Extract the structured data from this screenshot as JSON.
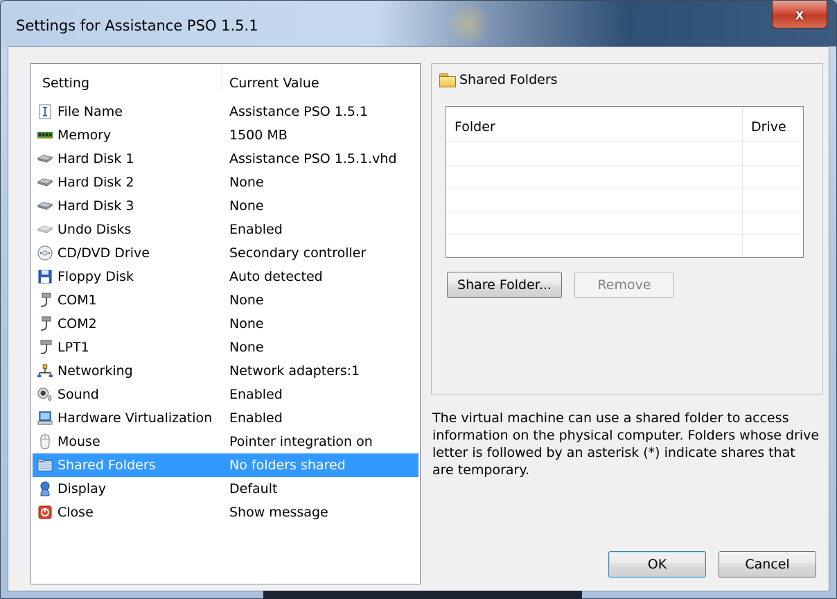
{
  "window": {
    "title": "Settings for Assistance PSO 1.5.1",
    "close_glyph": "x"
  },
  "settings_list": {
    "columns": [
      "Setting",
      "Current Value"
    ],
    "items": [
      {
        "icon": "file-name-icon",
        "label": "File Name",
        "value": "Assistance PSO 1.5.1"
      },
      {
        "icon": "memory-icon",
        "label": "Memory",
        "value": "1500 MB"
      },
      {
        "icon": "hard-disk-icon",
        "label": "Hard Disk 1",
        "value": "Assistance PSO 1.5.1.vhd"
      },
      {
        "icon": "hard-disk-icon",
        "label": "Hard Disk 2",
        "value": "None"
      },
      {
        "icon": "hard-disk-icon",
        "label": "Hard Disk 3",
        "value": "None"
      },
      {
        "icon": "undo-disks-icon",
        "label": "Undo Disks",
        "value": "Enabled"
      },
      {
        "icon": "cd-dvd-icon",
        "label": "CD/DVD Drive",
        "value": "Secondary controller"
      },
      {
        "icon": "floppy-disk-icon",
        "label": "Floppy Disk",
        "value": "Auto detected"
      },
      {
        "icon": "serial-port-icon",
        "label": "COM1",
        "value": "None"
      },
      {
        "icon": "serial-port-icon",
        "label": "COM2",
        "value": "None"
      },
      {
        "icon": "parallel-port-icon",
        "label": "LPT1",
        "value": "None"
      },
      {
        "icon": "networking-icon",
        "label": "Networking",
        "value": "Network adapters:1"
      },
      {
        "icon": "sound-icon",
        "label": "Sound",
        "value": "Enabled"
      },
      {
        "icon": "hardware-virtualization-icon",
        "label": "Hardware Virtualization",
        "value": "Enabled"
      },
      {
        "icon": "mouse-icon",
        "label": "Mouse",
        "value": "Pointer integration on"
      },
      {
        "icon": "shared-folders-icon",
        "label": "Shared Folders",
        "value": "No folders shared",
        "selected": true
      },
      {
        "icon": "display-icon",
        "label": "Display",
        "value": "Default"
      },
      {
        "icon": "close-setting-icon",
        "label": "Close",
        "value": "Show message"
      }
    ]
  },
  "shared_folders": {
    "group_title": "Shared Folders",
    "columns": [
      "Folder",
      "Drive"
    ],
    "share_button": "Share Folder...",
    "remove_button": "Remove",
    "description": "The virtual machine can use a shared folder to access information on the physical computer. Folders whose drive letter is followed by an asterisk (*) indicate shares that are temporary."
  },
  "footer": {
    "ok_button": "OK",
    "cancel_button": "Cancel"
  },
  "colors": {
    "selection": "#3399ff",
    "close_button": "#c23a24"
  }
}
